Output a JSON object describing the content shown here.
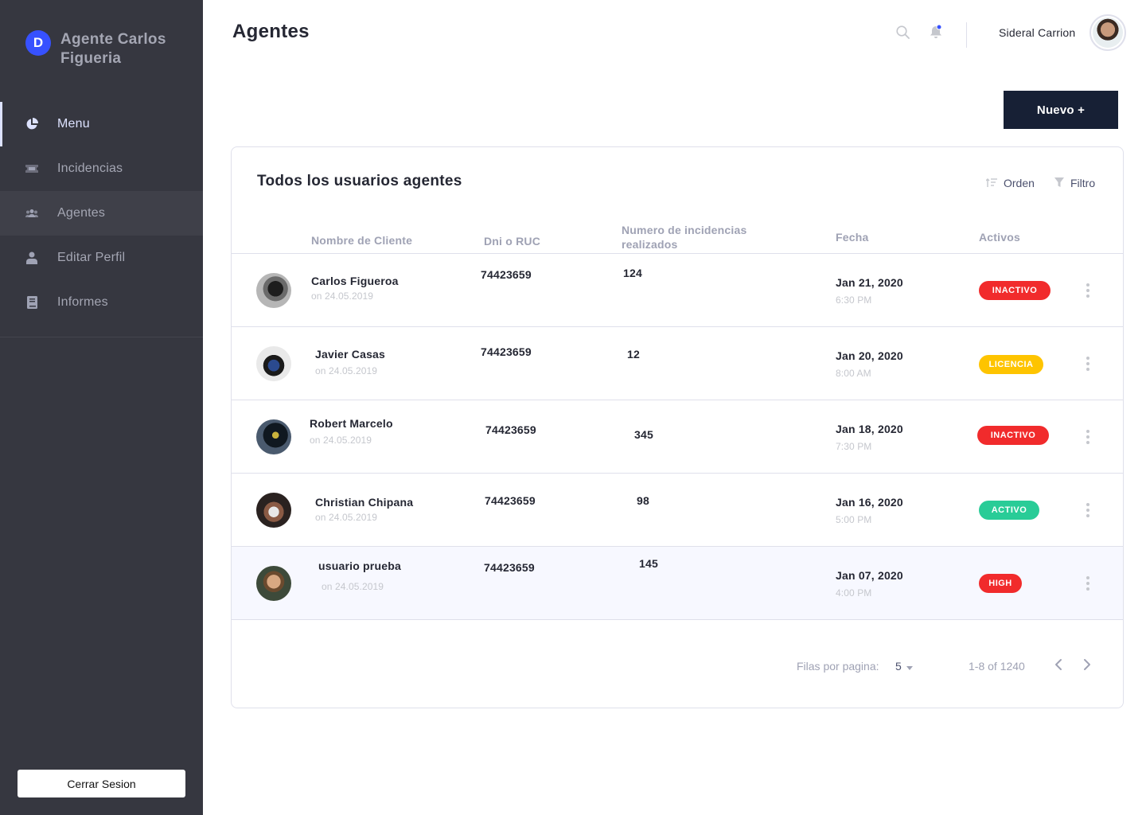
{
  "sidebar": {
    "brand_letter": "D",
    "brand_name": "Agente Carlos Figueria",
    "items": [
      {
        "label": "Menu",
        "icon": "pie-chart-icon"
      },
      {
        "label": "Incidencias",
        "icon": "ticket-icon"
      },
      {
        "label": "Agentes",
        "icon": "users-icon"
      },
      {
        "label": "Editar Perfil",
        "icon": "person-icon"
      },
      {
        "label": "Informes",
        "icon": "book-icon"
      }
    ],
    "logout_label": "Cerrar Sesion"
  },
  "header": {
    "title": "Agentes",
    "user_name": "Sideral Carrion",
    "search_icon": "search-icon",
    "bell_icon": "bell-icon"
  },
  "actions": {
    "new_label": "Nuevo  +"
  },
  "table": {
    "title": "Todos los usuarios agentes",
    "sort_label": "Orden",
    "filter_label": "Filtro",
    "columns": {
      "client": "Nombre de Cliente",
      "dni": "Dni o RUC",
      "incidents_line1": "Numero de incidencias",
      "incidents_line2": "realizados",
      "date": "Fecha",
      "status": "Activos"
    },
    "rows": [
      {
        "name": "Carlos Figueroa",
        "since": "on 24.05.2019",
        "dni": "74423659",
        "incidents": "124",
        "date": "Jan 21, 2020",
        "time": "6:30 PM",
        "status": "INACTIVO",
        "status_color": "#f12b2c"
      },
      {
        "name": "Javier Casas",
        "since": "on 24.05.2019",
        "dni": "74423659",
        "incidents": "12",
        "date": "Jan 20, 2020",
        "time": "8:00 AM",
        "status": "LICENCIA",
        "status_color": "#fec400"
      },
      {
        "name": "Robert Marcelo",
        "since": "on 24.05.2019",
        "dni": "74423659",
        "incidents": "345",
        "date": "Jan 18, 2020",
        "time": "7:30 PM",
        "status": "INACTIVO",
        "status_color": "#f12b2c"
      },
      {
        "name": "Christian Chipana",
        "since": "on 24.05.2019",
        "dni": "74423659",
        "incidents": "98",
        "date": "Jan 16, 2020",
        "time": "5:00 PM",
        "status": "ACTIVO",
        "status_color": "#29cc97"
      },
      {
        "name": "usuario prueba",
        "since": "on 24.05.2019",
        "dni": "74423659",
        "incidents": "145",
        "date": "Jan 07, 2020",
        "time": "4:00 PM",
        "status": "HIGH",
        "status_color": "#f12b2c"
      }
    ],
    "pagination": {
      "rows_label": "Filas por pagina:",
      "rows_value": "5",
      "range": "1-8 of 1240"
    }
  }
}
